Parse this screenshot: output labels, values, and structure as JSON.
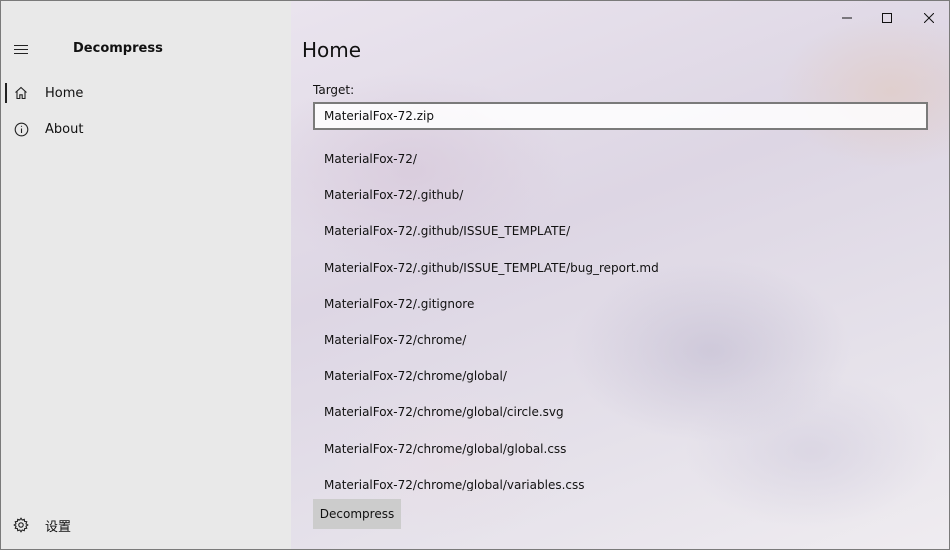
{
  "window": {
    "app_title": "Decompress"
  },
  "sidebar": {
    "items": [
      {
        "label": "Home",
        "icon": "home-icon"
      },
      {
        "label": "About",
        "icon": "info-icon"
      }
    ],
    "settings_label": "设置"
  },
  "main": {
    "title": "Home",
    "target_label": "Target:",
    "target_value": "MaterialFox-72.zip",
    "files": [
      "MaterialFox-72/",
      "MaterialFox-72/.github/",
      "MaterialFox-72/.github/ISSUE_TEMPLATE/",
      "MaterialFox-72/.github/ISSUE_TEMPLATE/bug_report.md",
      "MaterialFox-72/.gitignore",
      "MaterialFox-72/chrome/",
      "MaterialFox-72/chrome/global/",
      "MaterialFox-72/chrome/global/circle.svg",
      "MaterialFox-72/chrome/global/global.css",
      "MaterialFox-72/chrome/global/variables.css"
    ],
    "decompress_label": "Decompress"
  }
}
